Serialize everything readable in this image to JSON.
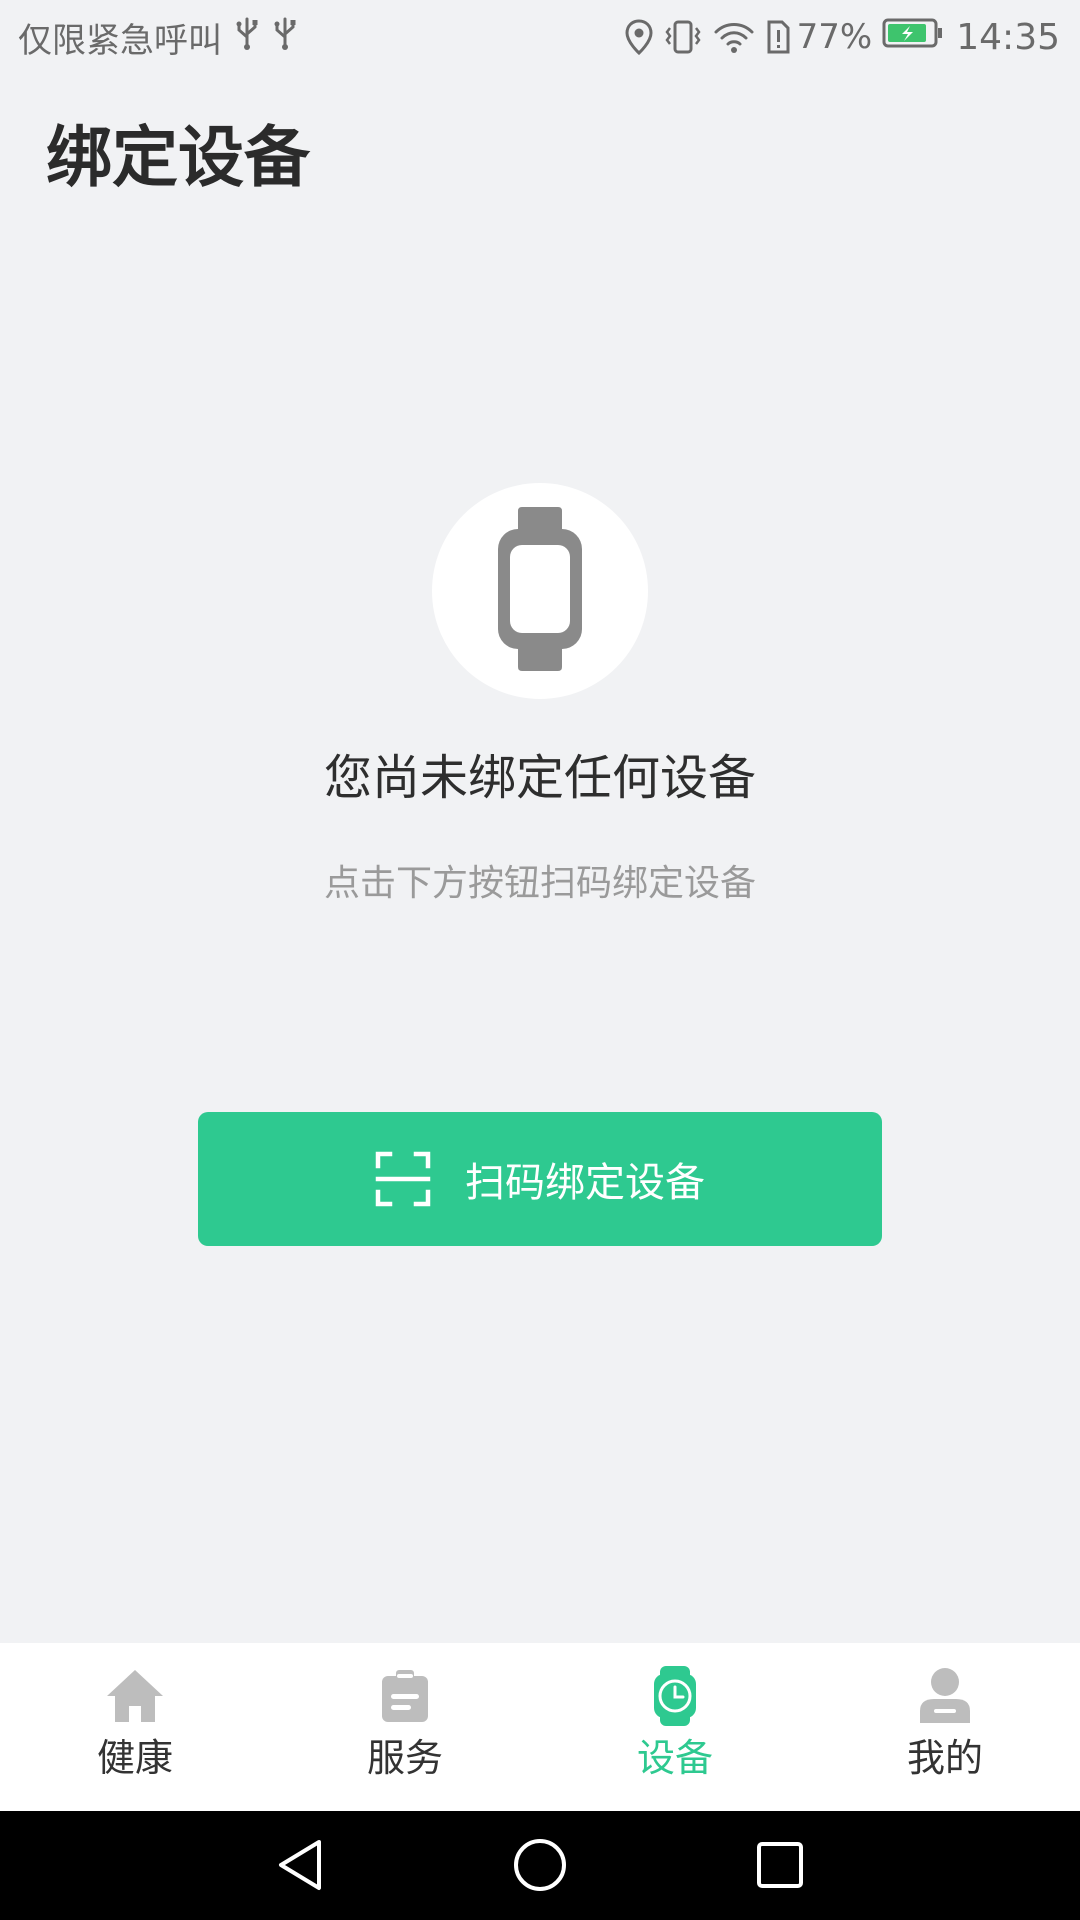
{
  "status_bar": {
    "carrier_text": "仅限紧急呼叫",
    "icons_left": [
      "usb-icon",
      "usb-icon"
    ],
    "icons_right": [
      "location-icon",
      "vibrate-icon",
      "wifi-icon",
      "sim-alert-icon"
    ],
    "battery_percent": "77%",
    "battery_state": "charging",
    "time": "14:35"
  },
  "page": {
    "title": "绑定设备"
  },
  "empty_state": {
    "icon": "smartwatch-icon",
    "title": "您尚未绑定任何设备",
    "subtitle": "点击下方按钮扫码绑定设备"
  },
  "scan_button": {
    "icon": "scan-icon",
    "label": "扫码绑定设备"
  },
  "tabs": [
    {
      "label": "健康",
      "icon": "home-icon",
      "active": false
    },
    {
      "label": "服务",
      "icon": "clipboard-icon",
      "active": false
    },
    {
      "label": "设备",
      "icon": "watch-icon",
      "active": true
    },
    {
      "label": "我的",
      "icon": "user-icon",
      "active": false
    }
  ],
  "system_nav": [
    "back-icon",
    "home-circle-icon",
    "recents-icon"
  ],
  "colors": {
    "accent": "#2ec990",
    "background": "#f1f2f4",
    "tab_inactive_icon": "#bdbdbd",
    "device_icon": "#8a8a8a"
  }
}
